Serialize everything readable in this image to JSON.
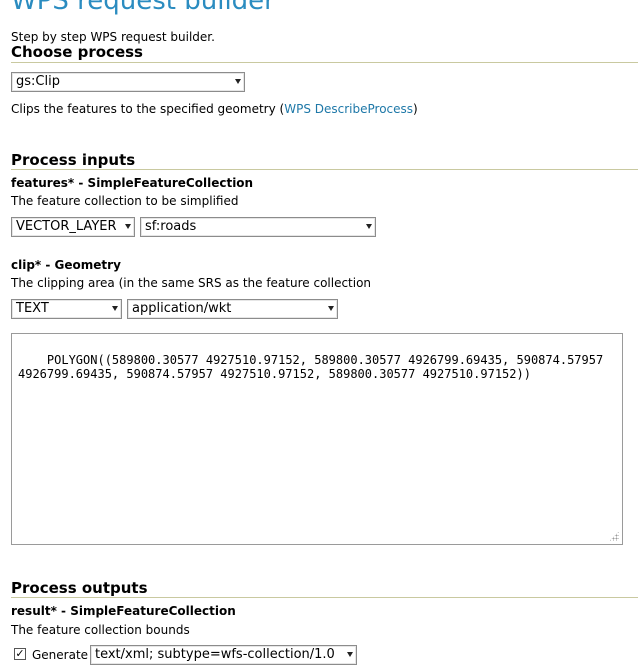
{
  "header": {
    "title": "WPS request builder",
    "subtitle": "Step by step WPS request builder."
  },
  "choose_process": {
    "heading": "Choose process",
    "selected_process": "gs:Clip",
    "description_prefix": "Clips the features to the specified geometry (",
    "describe_link": "WPS DescribeProcess",
    "description_suffix": ")"
  },
  "process_inputs": {
    "heading": "Process inputs",
    "features": {
      "label": "features* - SimpleFeatureCollection",
      "description": "The feature collection to be simplified",
      "source_type": "VECTOR_LAYER",
      "layer": "sf:roads"
    },
    "clip": {
      "label": "clip* - Geometry",
      "description": "The clipping area (in the same SRS as the feature collection",
      "source_type": "TEXT",
      "mime_type": "application/wkt",
      "value": "POLYGON((589800.30577 4927510.97152, 589800.30577 4926799.69435, 590874.57957 4926799.69435, 590874.57957 4927510.97152, 589800.30577 4927510.97152))"
    }
  },
  "process_outputs": {
    "heading": "Process outputs",
    "result": {
      "label": "result* - SimpleFeatureCollection",
      "description": "The feature collection bounds",
      "generate_label": "Generate",
      "generate_checked": "✓",
      "output_format": "text/xml; subtype=wfs-collection/1.0"
    }
  },
  "icons": {
    "dropdown": "chevron-down-icon",
    "checkbox": "check-icon",
    "resize": "resize-grip-icon"
  },
  "colors": {
    "title": "#2b8cc0",
    "link": "#1e78a8",
    "rule": "#c9c9a0"
  }
}
